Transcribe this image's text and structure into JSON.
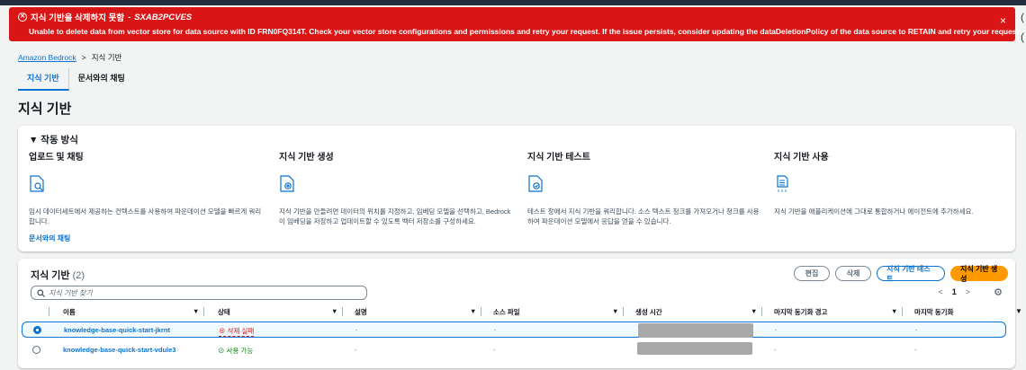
{
  "banner": {
    "title": "지식 기반을 삭제하지 못함",
    "id_sep": " - ",
    "id": "SXAB2PCVES",
    "message": "Unable to delete data from vector store for data source with ID FRN0FQ314T. Check your vector store configurations and permissions and retry your request. If the issue persists, consider updating the dataDeletionPolicy of the data source to RETAIN and retry your request.",
    "close": "×",
    "edge1": "(",
    "edge2": "("
  },
  "breadcrumb": {
    "root": "Amazon Bedrock",
    "sep": ">",
    "current": "지식 기반"
  },
  "tabs": [
    "지식 기반",
    "문서와의 채팅"
  ],
  "page_title": "지식 기반",
  "how": {
    "header": "▼ 작동 방식",
    "cols": [
      {
        "title": "업로드 및 채팅",
        "desc": "임시 데이터세트에서 제공하는 컨텍스트를 사용하여 파운데이션 모델을 빠르게 쿼리합니다.",
        "link": "문서와의 채팅"
      },
      {
        "title": "지식 기반 생성",
        "desc": "지식 기반을 만들려면 데이터의 위치를 지정하고, 임베딩 모델을 선택하고, Bedrock이 임베딩을 저장하고 업데이트할 수 있도록 벡터 저장소를 구성하세요.",
        "link": ""
      },
      {
        "title": "지식 기반 테스트",
        "desc": "테스트 창에서 지식 기반을 쿼리합니다. 소스 텍스트 청크를 가져오거나 청크를 사용하여 파운데이션 모델에서 응답을 얻을 수 있습니다.",
        "link": ""
      },
      {
        "title": "지식 기반 사용",
        "desc": "지식 기반을 애플리케이션에 그대로 통합하거나 에이전트에 추가하세요.",
        "link": ""
      }
    ]
  },
  "kb": {
    "title": "지식 기반",
    "count": "(2)",
    "buttons": {
      "edit": "편집",
      "delete": "삭제",
      "test": "지식 기반 테스트",
      "create": "지식 기반 생성"
    },
    "search_placeholder": "지식 기반 찾기",
    "pager": {
      "prev": "<",
      "page": "1",
      "next": ">"
    },
    "columns": [
      "이름",
      "상태",
      "설명",
      "소스 파일",
      "생성 시간",
      "마지막 동기화 경고",
      "마지막 동기화"
    ],
    "rows": [
      {
        "name": "knowledge-base-quick-start-jkrnt",
        "status": "삭제 실패",
        "desc": "-",
        "source": "-",
        "warn": "-",
        "sync": "-",
        "selected": true
      },
      {
        "name": "knowledge-base-quick-start-vdule3",
        "status": "사용 가능",
        "desc": "-",
        "source": "-",
        "warn": "-",
        "sync": "-",
        "selected": false
      }
    ]
  }
}
